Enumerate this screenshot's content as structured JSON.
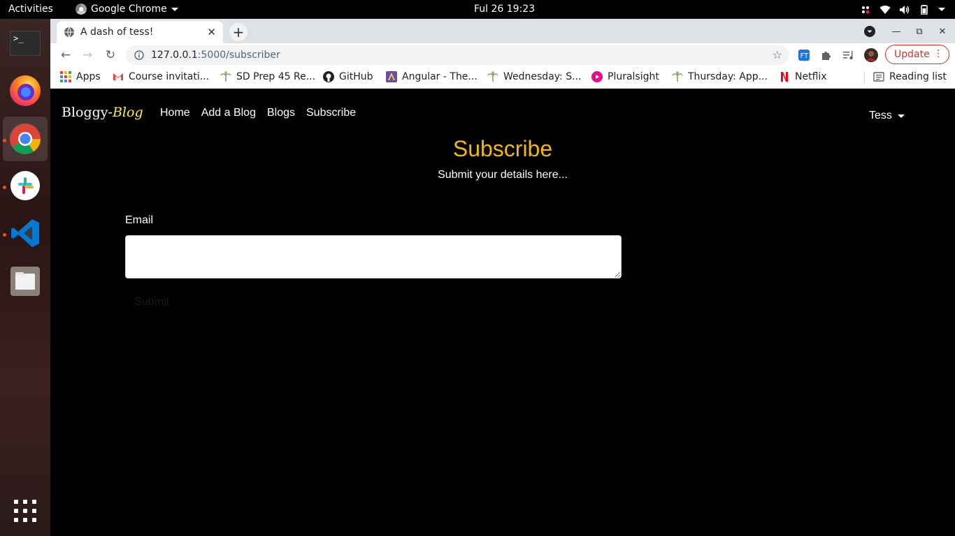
{
  "os": {
    "activities_label": "Activities",
    "app_menu_label": "Google Chrome",
    "clock": "Ful 26  19:23"
  },
  "dock": {
    "items": [
      "terminal",
      "firefox",
      "chrome",
      "slack",
      "vscode",
      "files",
      "show-apps"
    ]
  },
  "browser": {
    "tab_title": "A dash of tess!",
    "url_host": "127.0.0.1",
    "url_path": ":5000/subscriber",
    "update_label": "Update",
    "bookmarks": [
      {
        "label": "Apps"
      },
      {
        "label": "Course invitati..."
      },
      {
        "label": "SD Prep 45 Re..."
      },
      {
        "label": "GitHub"
      },
      {
        "label": "Angular - The..."
      },
      {
        "label": "Wednesday: S..."
      },
      {
        "label": "Pluralsight"
      },
      {
        "label": "Thursday: App..."
      },
      {
        "label": "Netflix"
      }
    ],
    "reading_list_label": "Reading list"
  },
  "page": {
    "brand_main": "Bloggy-",
    "brand_accent": "Blog",
    "nav": [
      {
        "label": "Home"
      },
      {
        "label": "Add a Blog"
      },
      {
        "label": "Blogs"
      },
      {
        "label": "Subscribe"
      }
    ],
    "user_name": "Tess",
    "title": "Subscribe",
    "subtitle": "Submit your details here...",
    "form": {
      "email_label": "Email",
      "email_value": "",
      "submit_label": "Submit"
    },
    "colors": {
      "heading": "#f5b800",
      "brand_accent": "#ffeb3b",
      "background": "#000000"
    }
  }
}
